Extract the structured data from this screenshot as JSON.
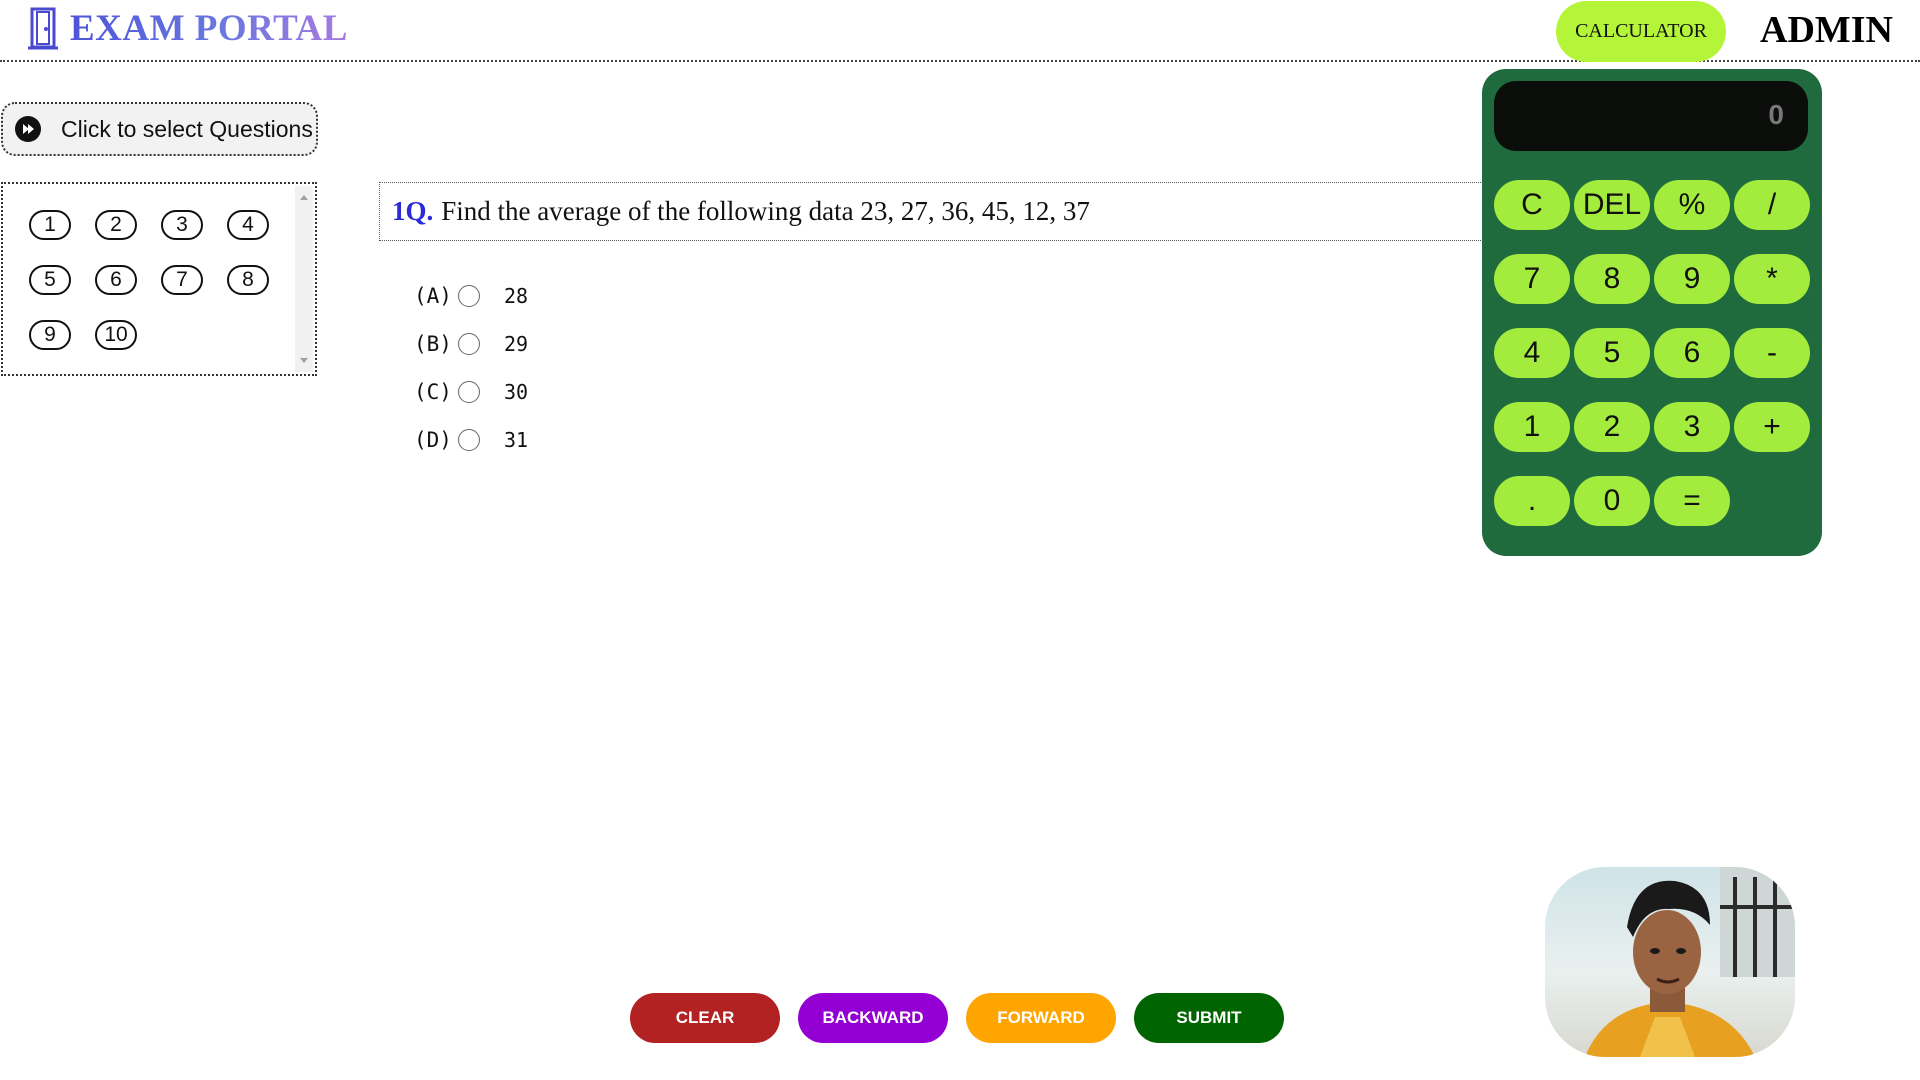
{
  "header": {
    "brand_title": "EXAM PORTAL",
    "brand_icon": "door-icon",
    "calculator_label": "CALCULATOR",
    "user_label": "ADMIN"
  },
  "question_selector": {
    "label": "Click to select Questions",
    "icon": "fast-forward-icon",
    "numbers": [
      "1",
      "2",
      "3",
      "4",
      "5",
      "6",
      "7",
      "8",
      "9",
      "10"
    ]
  },
  "question": {
    "number_label": "1Q.",
    "text": "Find the average of the following data 23, 27, 36, 45, 12, 37",
    "options": [
      {
        "letter": "(A)",
        "value": "28"
      },
      {
        "letter": "(B)",
        "value": "29"
      },
      {
        "letter": "(C)",
        "value": "30"
      },
      {
        "letter": "(D)",
        "value": "31"
      }
    ]
  },
  "calculator": {
    "display": "0",
    "keys": [
      "C",
      "DEL",
      "%",
      "/",
      "7",
      "8",
      "9",
      "*",
      "4",
      "5",
      "6",
      "-",
      "1",
      "2",
      "3",
      "+",
      ".",
      "0",
      "="
    ]
  },
  "actions": {
    "clear": "CLEAR",
    "backward": "BACKWARD",
    "forward": "FORWARD",
    "submit": "SUBMIT"
  },
  "colors": {
    "accent_green": "#b4f53a",
    "calc_body": "#1f6b3d",
    "calc_key": "#a3ec3d",
    "clear": "#b22222",
    "backward": "#9400d3",
    "forward": "#ffa500",
    "submit": "#006400",
    "question_number": "#2a2ad8"
  }
}
